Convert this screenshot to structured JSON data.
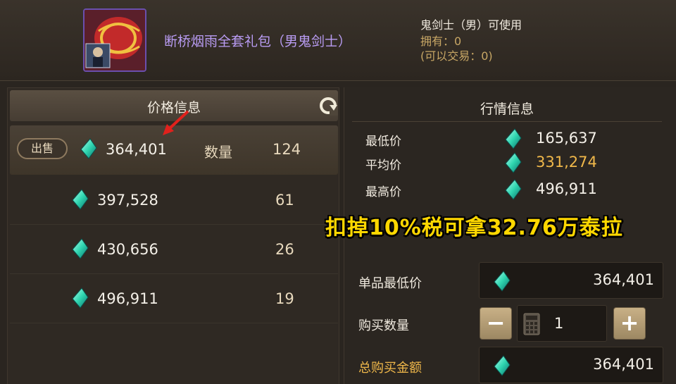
{
  "item": {
    "name": "断桥烟雨全套礼包（男鬼剑士）",
    "usable_by": "鬼剑士（男）可使用",
    "owned": "拥有：0",
    "tradable": "(可以交易：0)",
    "icon": "gift-box-icon"
  },
  "price_panel": {
    "title": "价格信息",
    "sell_label": "出售",
    "qty_label": "数量",
    "listings": [
      {
        "price": "364,401",
        "qty": "124"
      },
      {
        "price": "397,528",
        "qty": "61"
      },
      {
        "price": "430,656",
        "qty": "26"
      },
      {
        "price": "496,911",
        "qty": "19"
      }
    ]
  },
  "market_panel": {
    "title": "行情信息",
    "min_label": "最低价",
    "min_value": "165,637",
    "avg_label": "平均价",
    "avg_value": "331,274",
    "max_label": "最高价",
    "max_value": "496,911"
  },
  "overlay_caption": "扣掉10%税可拿32.76万泰拉",
  "purchase": {
    "unit_min_label": "单品最低价",
    "unit_min_value": "364,401",
    "qty_label": "购买数量",
    "qty_value": "1",
    "minus": "−",
    "plus": "+",
    "total_label": "总购买金额",
    "total_value": "364,401"
  },
  "colors": {
    "item_name": "#b99cf3",
    "gold": "#f0b84a",
    "overlay": "#ffd700",
    "gem": "#2fd6b0"
  }
}
